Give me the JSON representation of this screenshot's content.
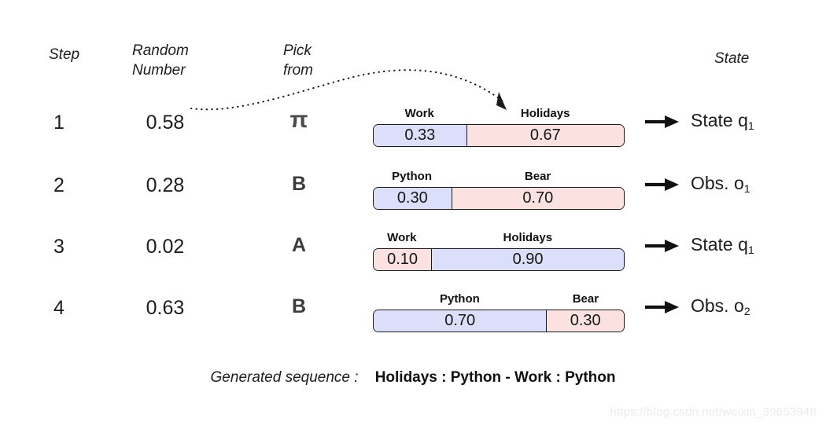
{
  "headers": {
    "step": "Step",
    "random_number": "Random\nNumber",
    "pick_from": "Pick\nfrom",
    "state": "State"
  },
  "colors": {
    "blue_fill": "#dcdffa",
    "pink_fill": "#fbe2e0",
    "outline": "#1a1a1a"
  },
  "rows": [
    {
      "step": "1",
      "random_number": "0.58",
      "pick_from": "π",
      "segments": [
        {
          "label": "Work",
          "value": "0.33",
          "fraction": 37,
          "color": "blue"
        },
        {
          "label": "Holidays",
          "value": "0.67",
          "fraction": 63,
          "color": "pink"
        }
      ],
      "result_prefix": "State q",
      "result_sub": "1",
      "arrow": "right-arrow-icon"
    },
    {
      "step": "2",
      "random_number": "0.28",
      "pick_from": "B",
      "segments": [
        {
          "label": "Python",
          "value": "0.30",
          "fraction": 31,
          "color": "blue"
        },
        {
          "label": "Bear",
          "value": "0.70",
          "fraction": 69,
          "color": "pink"
        }
      ],
      "result_prefix": "Obs. o",
      "result_sub": "1",
      "arrow": "right-arrow-icon"
    },
    {
      "step": "3",
      "random_number": "0.02",
      "pick_from": "A",
      "segments": [
        {
          "label": "Work",
          "value": "0.10",
          "fraction": 23,
          "color": "pink"
        },
        {
          "label": "Holidays",
          "value": "0.90",
          "fraction": 77,
          "color": "blue"
        }
      ],
      "result_prefix": "State q",
      "result_sub": "1",
      "arrow": "right-arrow-icon"
    },
    {
      "step": "4",
      "random_number": "0.63",
      "pick_from": "B",
      "segments": [
        {
          "label": "Python",
          "value": "0.70",
          "fraction": 69,
          "color": "blue"
        },
        {
          "label": "Bear",
          "value": "0.30",
          "fraction": 31,
          "color": "pink"
        }
      ],
      "result_prefix": "Obs. o",
      "result_sub": "2",
      "arrow": "right-arrow-icon"
    }
  ],
  "footer": {
    "lead": "Generated sequence :",
    "sequence": "Holidays : Python - Work : Python"
  },
  "watermark": "https://blog.csdn.net/weixin_39653948"
}
